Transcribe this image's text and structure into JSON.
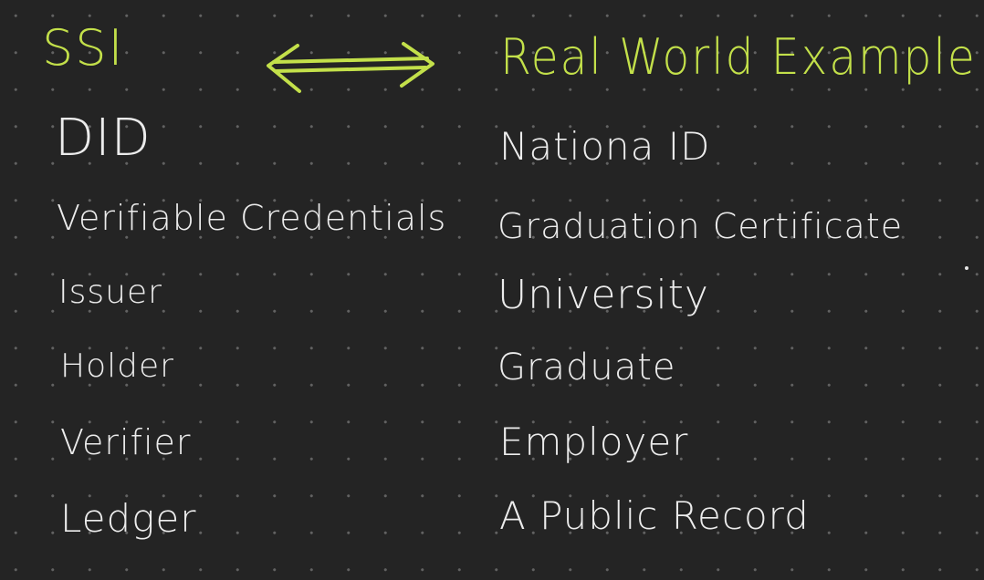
{
  "header": {
    "left": "SSI",
    "right": "Real World Example",
    "arrow_icon": "double-headed-arrow-icon",
    "accent_color": "#c3e04a"
  },
  "rows": [
    {
      "term": "DID",
      "example": "Nationa ID"
    },
    {
      "term": "Verifiable Credentials",
      "example": "Graduation Certificate"
    },
    {
      "term": "Issuer",
      "example": "University"
    },
    {
      "term": "Holder",
      "example": "Graduate"
    },
    {
      "term": "Verifier",
      "example": "Employer"
    },
    {
      "term": "Ledger",
      "example": "A Public Record"
    }
  ],
  "colors": {
    "background": "#242424",
    "text": "#ececec",
    "grid_dot": "#7a7a7a"
  }
}
